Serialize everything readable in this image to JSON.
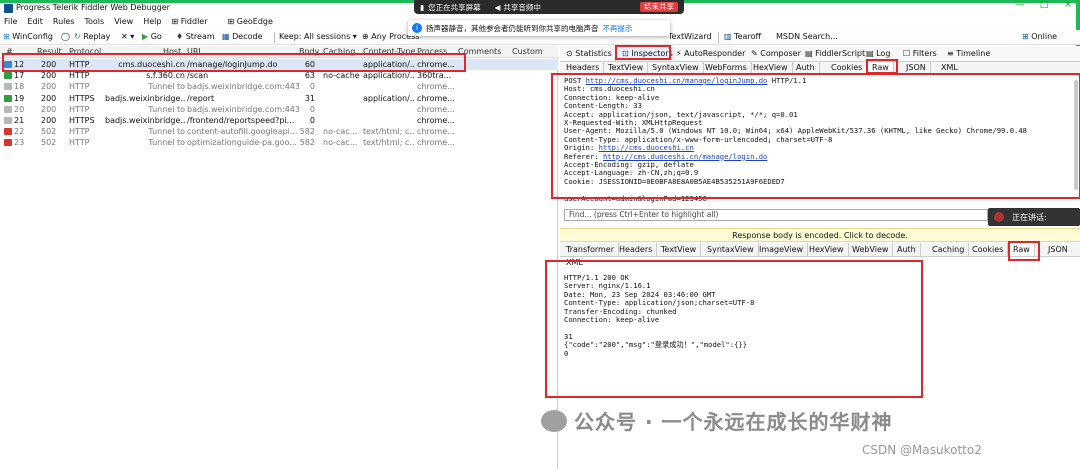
{
  "window": {
    "title": "Progress Telerik Fiddler Web Debugger",
    "min": "—",
    "max": "□",
    "close": "×"
  },
  "share": {
    "status": "您正在共享屏幕",
    "audio": "共享音频中",
    "stop": "结束共享"
  },
  "notice": {
    "text": "扬声器静音，其他参会者仍能听到你共享的电脑声音",
    "link": "不再提示"
  },
  "menu": [
    "File",
    "Edit",
    "Rules",
    "Tools",
    "View",
    "Help",
    "Fiddler",
    "GeoEdge"
  ],
  "toolbar": {
    "winconfig": "WinConfig",
    "replay": "Replay",
    "remove": "✕ ▾",
    "go": "Go",
    "stream": "Stream",
    "decode": "Decode",
    "keep": "Keep: All sessions ▾",
    "any_process": "Any Process",
    "textwizard": "TextWizard",
    "tearoff": "Tearoff",
    "msdn": "MSDN Search...",
    "online": "Online"
  },
  "sessions": {
    "columns": [
      "#",
      "Result",
      "Protocol",
      "Host",
      "URL",
      "Body",
      "Caching",
      "Content-Type",
      "Process",
      "Comments",
      "Custom"
    ],
    "rows": [
      {
        "id": "12",
        "result": "200",
        "protocol": "HTTP",
        "host": "cms.duoceshi.cn",
        "url": "/manage/loginJump.do",
        "body": "60",
        "caching": "",
        "ctype": "application/...",
        "process": "chrome...",
        "icon": "#3a86d1",
        "gray": false,
        "sel": true
      },
      {
        "id": "17",
        "result": "200",
        "protocol": "HTTP",
        "host": "s.f.360.cn",
        "url": "/scan",
        "body": "63",
        "caching": "no-cache",
        "ctype": "application/...",
        "process": "360tra...",
        "icon": "#2e9e3e",
        "gray": false,
        "sel": false
      },
      {
        "id": "18",
        "result": "200",
        "protocol": "HTTP",
        "host": "Tunnel to",
        "url": "badjs.weixinbridge.com:443",
        "body": "0",
        "caching": "",
        "ctype": "",
        "process": "chrome...",
        "icon": "#b8b8b8",
        "gray": true,
        "sel": false
      },
      {
        "id": "19",
        "result": "200",
        "protocol": "HTTPS",
        "host": "badjs.weixinbridge....",
        "url": "/report",
        "body": "31",
        "caching": "",
        "ctype": "application/...",
        "process": "chrome...",
        "icon": "#2e9e3e",
        "gray": false,
        "sel": false
      },
      {
        "id": "20",
        "result": "200",
        "protocol": "HTTP",
        "host": "Tunnel to",
        "url": "badjs.weixinbridge.com:443",
        "body": "0",
        "caching": "",
        "ctype": "",
        "process": "chrome...",
        "icon": "#b8b8b8",
        "gray": true,
        "sel": false
      },
      {
        "id": "21",
        "result": "200",
        "protocol": "HTTPS",
        "host": "badjs.weixinbridge....",
        "url": "/frontend/reportspeed?pi...",
        "body": "0",
        "caching": "",
        "ctype": "",
        "process": "chrome...",
        "icon": "#b8b8b8",
        "gray": false,
        "sel": false
      },
      {
        "id": "22",
        "result": "502",
        "protocol": "HTTP",
        "host": "Tunnel to",
        "url": "content-autofill.googleapi...",
        "body": "582",
        "caching": "no-cac...",
        "ctype": "text/html; c...",
        "process": "chrome...",
        "icon": "#d9342b",
        "gray": true,
        "sel": false
      },
      {
        "id": "23",
        "result": "502",
        "protocol": "HTTP",
        "host": "Tunnel to",
        "url": "optimizationguide-pa.goo...",
        "body": "582",
        "caching": "no-cac...",
        "ctype": "text/html; c...",
        "process": "chrome...",
        "icon": "#d9342b",
        "gray": true,
        "sel": false
      }
    ]
  },
  "inspector_tabs": [
    "Statistics",
    "Inspectors",
    "AutoResponder",
    "Composer",
    "FiddlerScript",
    "Log",
    "Filters",
    "Timeline"
  ],
  "request_tabs": [
    "Headers",
    "TextView",
    "SyntaxView",
    "WebForms",
    "HexView",
    "Auth",
    "Cookies",
    "Raw",
    "JSON",
    "XML"
  ],
  "request_raw": {
    "line1_pre": "POST ",
    "line1_link": "http://cms.duoceshi.cn/manage/loginJump.do",
    "line1_post": " HTTP/1.1",
    "headers1": "Host: cms.duoceshi.cn\nConnection: keep-alive\nContent-Length: 33\nAccept: application/json, text/javascript, */*; q=0.01\nX-Requested-With: XMLHttpRequest\nUser-Agent: Mozilla/5.0 (Windows NT 10.0; Win64; x64) AppleWebKit/537.36 (KHTML, like Gecko) Chrome/99.0.48\nContent-Type: application/x-www-form-urlencoded; charset=UTF-8",
    "origin_pre": "Origin: ",
    "origin_link": "http://cms.duoceshi.cn",
    "referer_pre": "Referer: ",
    "referer_link": "http://cms.duoceshi.cn/manage/login.do",
    "headers2": "Accept-Encoding: gzip, deflate\nAccept-Language: zh-CN,zh;q=0.9\nCookie: JSESSIONID=0E0BFA8E8A0B5AE4B535251A9F6EDED7",
    "body": "userAccount=admin&loginPwd=123456"
  },
  "find": {
    "placeholder": "Find... (press Ctrl+Enter to highlight all)"
  },
  "decode_bar": "Response body is encoded. Click to decode.",
  "response_tabs": [
    "Transformer",
    "Headers",
    "TextView",
    "SyntaxView",
    "ImageView",
    "HexView",
    "WebView",
    "Auth",
    "Caching",
    "Cookies",
    "Raw",
    "JSON",
    "XML"
  ],
  "response_raw": "HTTP/1.1 200 OK\nServer: nginx/1.16.1\nDate: Mon, 23 Sep 2024 03:46:00 GMT\nContent-Type: application/json;charset=UTF-8\nTransfer-Encoding: chunked\nConnection: keep-alive\n\n31\n{\"code\":\"200\",\"msg\":\"登录成功！\",\"model\":{}}\n0",
  "speaking": "正在讲话:",
  "watermark": "公众号 · 一个永远在成长的华财神",
  "csdn": "CSDN @Masukotto2",
  "colors": {
    "highlight": "#e0262b",
    "link": "#1a3fc4",
    "accent_green": "#1db954"
  }
}
